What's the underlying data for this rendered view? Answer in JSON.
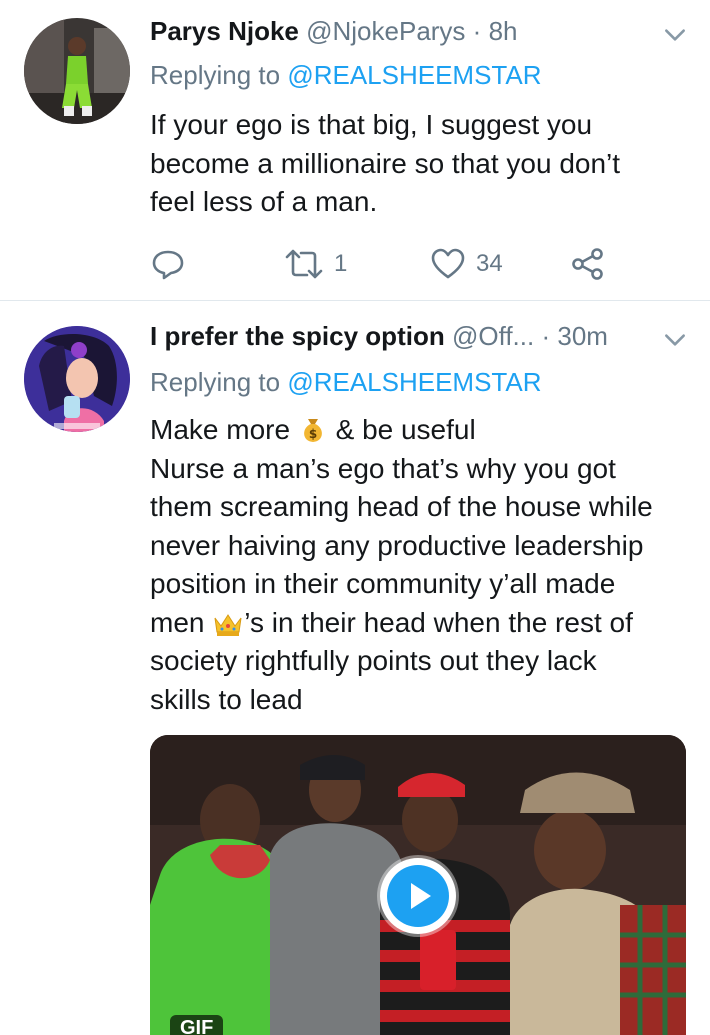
{
  "tweets": [
    {
      "name": "Parys Njoke",
      "handle": "@NjokeParys",
      "separator": "·",
      "time": "8h",
      "replying_prefix": "Replying to ",
      "replying_to": "@REALSHEEMSTAR",
      "text_lines": [
        "If your ego is that big, I suggest you",
        "become a millionaire so that you don’t",
        "feel less of a man."
      ],
      "retweet_count": "1",
      "like_count": "34",
      "icons": [
        "reply-icon",
        "retweet-icon",
        "heart-icon",
        "share-icon",
        "chevron-down-icon"
      ]
    },
    {
      "name": "I prefer the spicy option",
      "handle": "@Off...",
      "separator": "·",
      "time": "30m",
      "replying_prefix": "Replying to ",
      "replying_to": "@REALSHEEMSTAR",
      "line1_before": "Make more ",
      "line1_after": " & be useful",
      "text_lines": [
        "Nurse a man’s ego that’s why you got",
        "them screaming head of the house while",
        "never haiving any productive leadership",
        "position in their community y’all made"
      ],
      "line6_before": "men ",
      "line6_after": "’s in their head when the rest of",
      "text_lines_end": [
        "society rightfully points out they lack",
        "skills to lead"
      ],
      "media_badge": "GIF",
      "icons": [
        "money-bag-emoji",
        "crown-emoji",
        "play-icon",
        "chevron-down-icon"
      ]
    }
  ],
  "colors": {
    "accent": "#1da1f2",
    "secondary_text": "#657786",
    "divider": "#e1e8ed"
  }
}
